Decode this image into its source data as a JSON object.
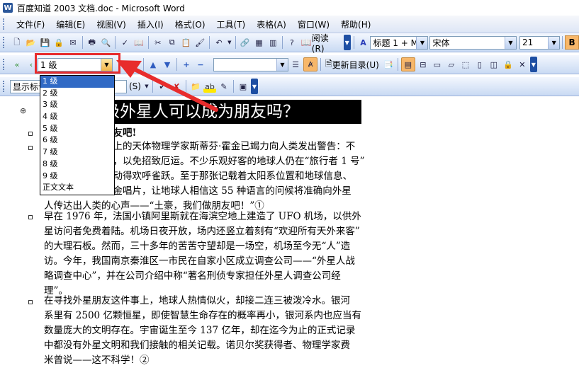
{
  "window": {
    "title": "百度知道 2003 文档.doc - Microsoft Word",
    "app_icon": "W"
  },
  "menu": [
    "文件(F)",
    "编辑(E)",
    "视图(V)",
    "插入(I)",
    "格式(O)",
    "工具(T)",
    "表格(A)",
    "窗口(W)",
    "帮助(H)"
  ],
  "toolbar1": {
    "read_label": "阅读(R)",
    "style_value": "标题 1 + M",
    "font_value": "宋体",
    "size_value": "21",
    "bold_label": "B"
  },
  "outline_toolbar": {
    "level_value": "1 级",
    "update_toc_label": "更新目录(U)"
  },
  "toolbar3": {
    "show_level_label": "显示标记",
    "partial_label": "(S)"
  },
  "level_dropdown": [
    "1 级",
    "2 级",
    "3 级",
    "4 级",
    "5 级",
    "6 级",
    "7 级",
    "8 级",
    "9 级",
    "正文文本"
  ],
  "document": {
    "heading": "级外星人可以成为朋友吗？",
    "sub1": "朋友吧!",
    "p1_lines": [
      "椅上的天体物理学家斯蒂芬·霍金已竭力向人类发出警告：不",
      "话，以免招致厄运。不少乐观好客的地球人仍在“旅行者 1 号”",
      "激动得欢呼雀跃。至于那张记载着太阳系位置和地球信息、",
      "的金唱片，让地球人相信这 55 种语言的问候将准确向外星",
      "人传达出人类的心声——“土豪，我们做朋友吧！”①"
    ],
    "p2_lines": [
      "早在 1976 年，法国小镇阿里斯就在海滨空地上建造了 UFO 机场，以供外",
      "星访问者免费着陆。机场日夜开放，场内还竖立着刻有“欢迎所有天外来客”",
      "的大理石板。然而，三十多年的苦苦守望却是一场空，机场至今无“人”造",
      "访。今年，我国南京秦淮区一市民在自家小区成立调查公司——“外星人战",
      "略调查中心”，并在公司介绍中称“著名刑侦专家担任外星人调查公司经",
      "理”。"
    ],
    "p3_lines": [
      "在寻找外星朋友这件事上，地球人热情似火，却接二连三被泼冷水。银河",
      "系里有 2500 亿颗恒星，即使智慧生命存在的概率再小，银河系内也应当有",
      "数量庞大的文明存在。宇宙诞生至今 137 亿年，却在迄今为止的正式记录",
      "中都没有外星文明和我们接触的相关记载。诺贝尔奖获得者、物理学家费",
      "米曾说——这不科学！②"
    ]
  }
}
